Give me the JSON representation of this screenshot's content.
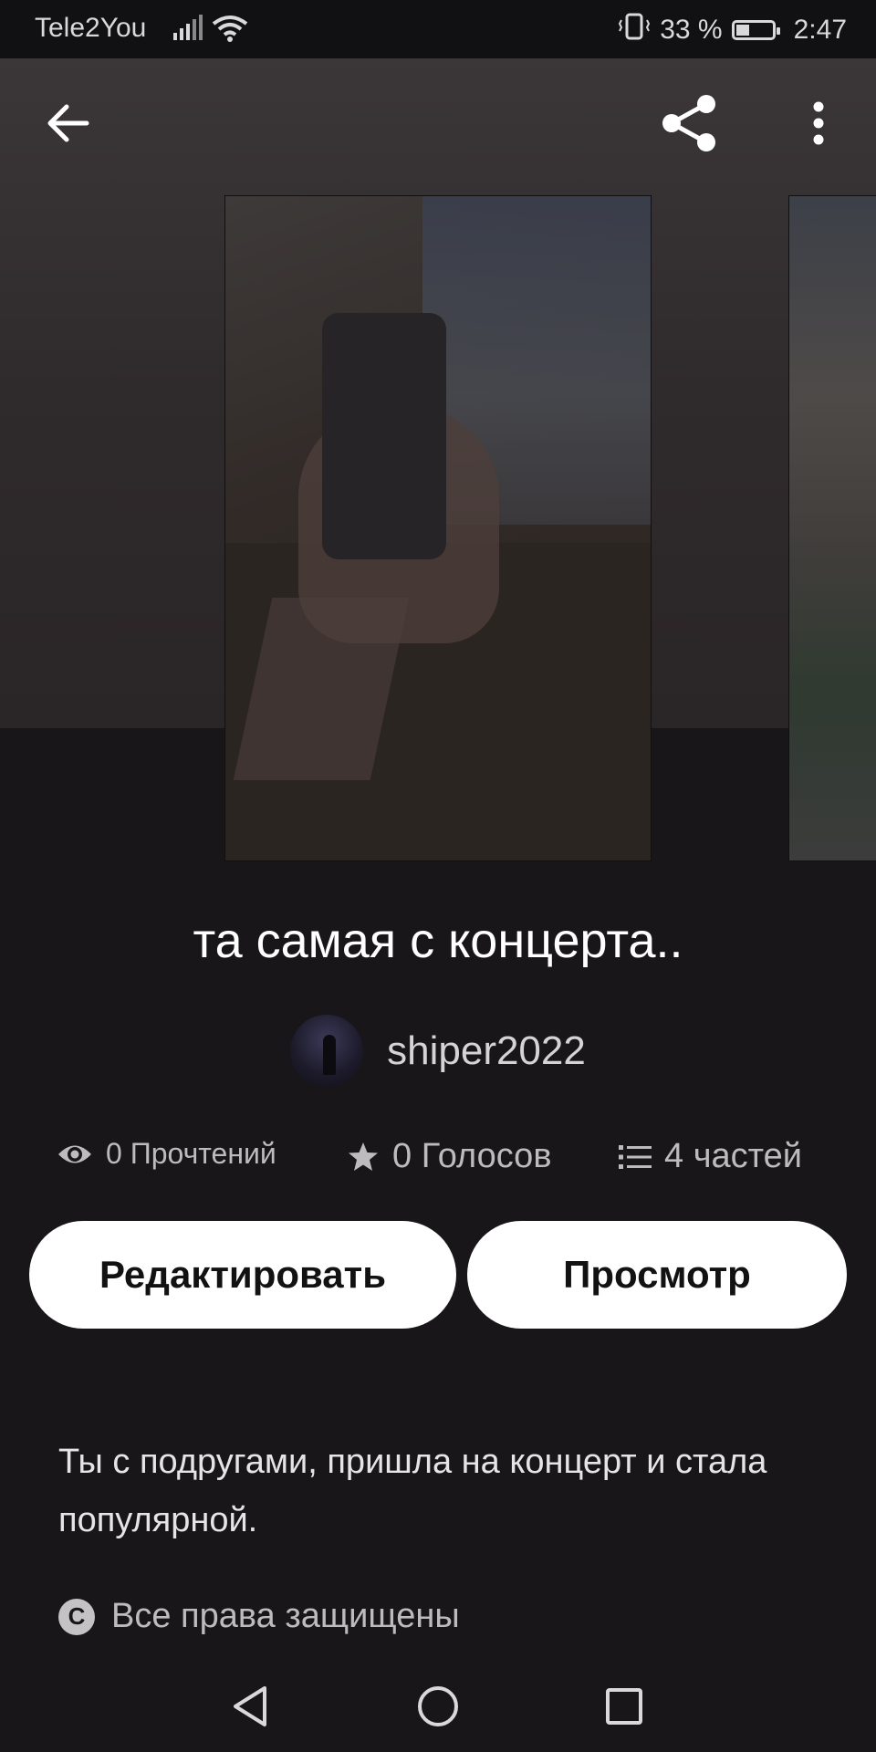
{
  "status_bar": {
    "carrier": "Tele2You",
    "battery_text": "33 %",
    "time": "2:47"
  },
  "story": {
    "title": "та самая с концерта..",
    "author": "shiper2022",
    "description": "Ты с подругами, пришла на концерт и стала популярной.",
    "copyright": "Все права защищены"
  },
  "stats": {
    "reads": "0 Прочтений",
    "votes": "0 Голосов",
    "parts": "4 частей"
  },
  "buttons": {
    "edit": "Редактировать",
    "view": "Просмотр"
  },
  "icons": {
    "back": "arrow-left-icon",
    "share": "share-icon",
    "more": "more-vertical-icon",
    "reads": "eye-icon",
    "votes": "star-icon",
    "parts": "list-icon",
    "copyright": "copyright-icon"
  }
}
